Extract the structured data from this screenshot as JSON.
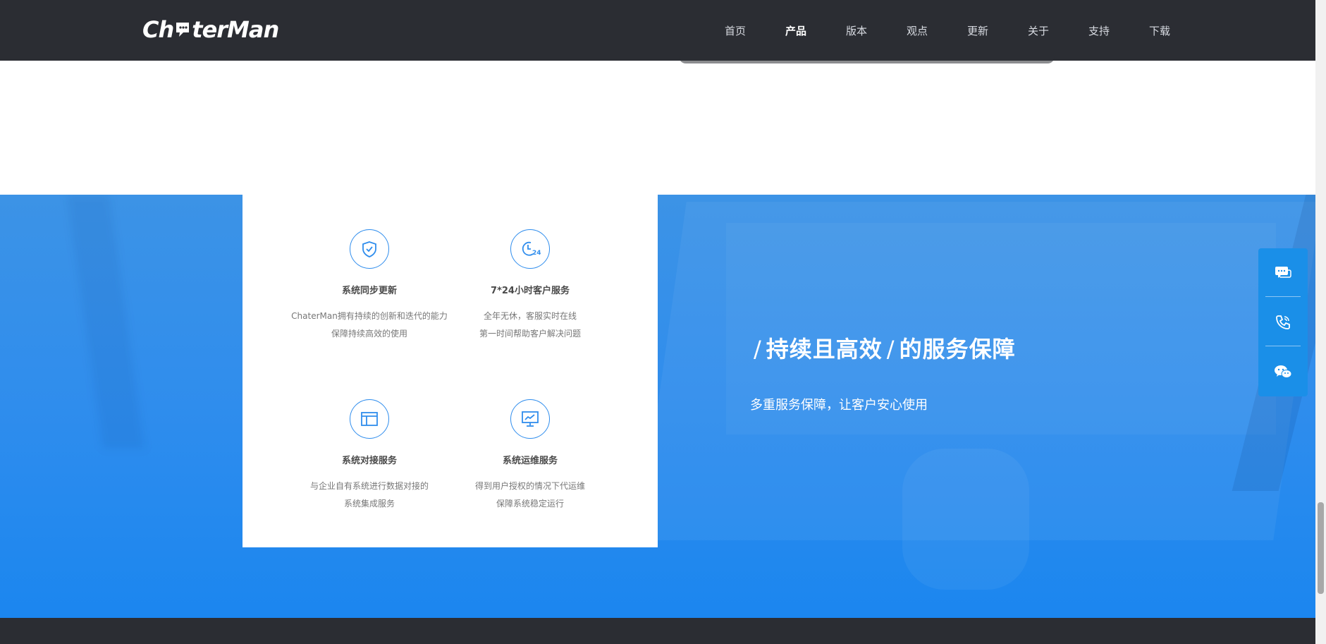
{
  "header": {
    "logo_text": "ChaterMan",
    "nav": [
      {
        "label": "首页"
      },
      {
        "label": "产品"
      },
      {
        "label": "版本"
      },
      {
        "label": "观点"
      },
      {
        "label": "更新"
      },
      {
        "label": "关于"
      },
      {
        "label": "支持"
      },
      {
        "label": "下载"
      }
    ],
    "active_nav": "产品"
  },
  "features": [
    {
      "icon": "shield-check-icon",
      "title": "系统同步更新",
      "desc_line1": "ChaterMan拥有持续的创新和迭代的能力",
      "desc_line2": "保障持续高效的使用"
    },
    {
      "icon": "clock-24-icon",
      "title": "7*24小时客户服务",
      "desc_line1": "全年无休，客服实时在线",
      "desc_line2": "第一时间帮助客户解决问题"
    },
    {
      "icon": "layout-panel-icon",
      "title": "系统对接服务",
      "desc_line1": "与企业自有系统进行数据对接的",
      "desc_line2": "系统集成服务"
    },
    {
      "icon": "monitor-chart-icon",
      "title": "系统运维服务",
      "desc_line1": "得到用户授权的情况下代运维",
      "desc_line2": "保障系统稳定运行"
    }
  ],
  "slogan": {
    "slash": "/",
    "part1": "持续且高效",
    "part2": "的服务保障"
  },
  "subtext": "多重服务保障，让客户安心使用",
  "side_tools": [
    {
      "icon": "chat-bubbles-icon"
    },
    {
      "icon": "phone-icon"
    },
    {
      "icon": "wechat-icon"
    }
  ],
  "colors": {
    "header_bg": "#2b2d33",
    "accent_blue": "#2f8ded",
    "side_tool_bg": "#1a8fe8"
  }
}
